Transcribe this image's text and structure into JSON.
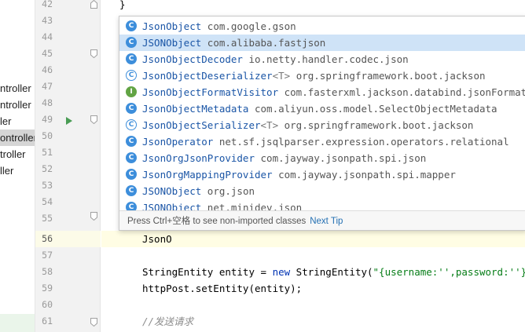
{
  "tree": {
    "items": [
      {
        "label": "ntroller"
      },
      {
        "label": "ntroller"
      },
      {
        "label": "ler"
      },
      {
        "label": "ontroller"
      },
      {
        "label": "troller"
      },
      {
        "label": "ller"
      }
    ]
  },
  "gutter": {
    "line_numbers": [
      "42",
      "43",
      "44",
      "45",
      "46",
      "47",
      "48",
      "49",
      "50",
      "51",
      "52",
      "53",
      "54",
      "55",
      "56",
      "57",
      "58",
      "59",
      "60",
      "61"
    ]
  },
  "editor": {
    "closing_brace": "}",
    "typed": "JsonO",
    "line58_type": "StringEntity entity = ",
    "line58_kw": "new",
    "line58_call": " StringEntity(",
    "line58_str": "\"{username:'',password:''}\"",
    "line58_end": ");",
    "line59": "httpPost.setEntity(entity);",
    "line61_comment": "//发送请求"
  },
  "completion": {
    "items": [
      {
        "icon": "C",
        "name": "JsonObject",
        "type_params": "",
        "package": "com.google.gson"
      },
      {
        "icon": "C",
        "name": "JSONObject",
        "type_params": "",
        "package": "com.alibaba.fastjson"
      },
      {
        "icon": "C",
        "name": "JsonObjectDecoder",
        "type_params": "",
        "package": "io.netty.handler.codec.json"
      },
      {
        "icon": "C",
        "name": "JsonObjectDeserializer",
        "type_params": "<T>",
        "package": "org.springframework.boot.jackson"
      },
      {
        "icon": "I",
        "name": "JsonObjectFormatVisitor",
        "type_params": "",
        "package": "com.fasterxml.jackson.databind.jsonFormatVisi"
      },
      {
        "icon": "C",
        "name": "JsonObjectMetadata",
        "type_params": "",
        "package": "com.aliyun.oss.model.SelectObjectMetadata"
      },
      {
        "icon": "C",
        "name": "JsonObjectSerializer",
        "type_params": "<T>",
        "package": "org.springframework.boot.jackson"
      },
      {
        "icon": "C",
        "name": "JsonOperator",
        "type_params": "",
        "package": "net.sf.jsqlparser.expression.operators.relational"
      },
      {
        "icon": "C",
        "name": "JsonOrgJsonProvider",
        "type_params": "",
        "package": "com.jayway.jsonpath.spi.json"
      },
      {
        "icon": "C",
        "name": "JsonOrgMappingProvider",
        "type_params": "",
        "package": "com.jayway.jsonpath.spi.mapper"
      },
      {
        "icon": "C",
        "name": "JSONObject",
        "type_params": "",
        "package": "org.json"
      },
      {
        "icon": "C",
        "name": "JSONObject",
        "type_params": "",
        "package": "net.minidev.json"
      }
    ],
    "hint": "Press Ctrl+空格 to see non-imported classes",
    "hint_link": "Next Tip"
  }
}
